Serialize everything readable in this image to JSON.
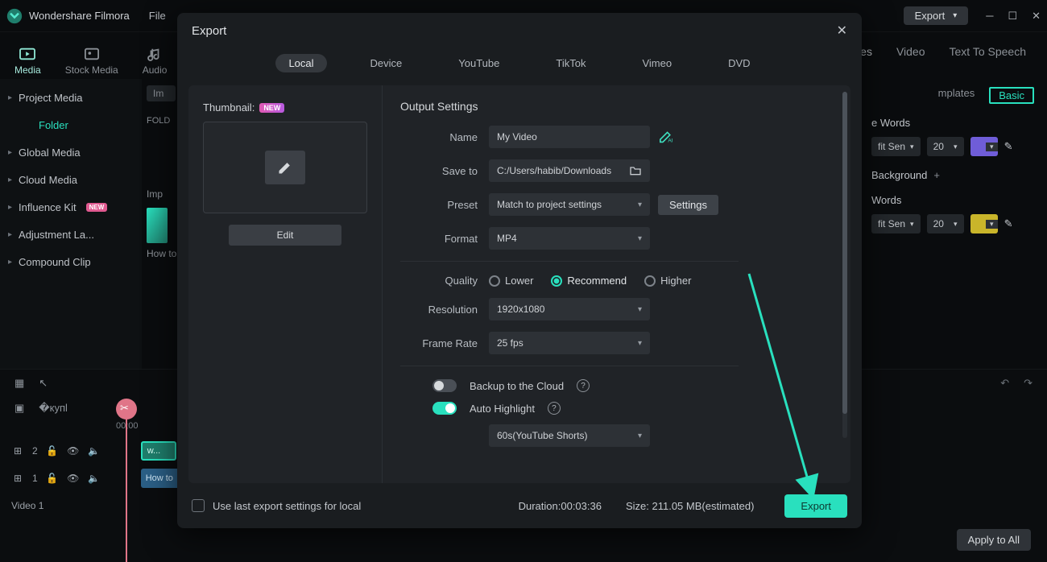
{
  "app": {
    "title": "Wondershare Filmora",
    "menu": [
      "File"
    ],
    "export_btn": "Export"
  },
  "nav": {
    "media": "Media",
    "stock": "Stock Media",
    "audio": "Audio"
  },
  "top_tabs": {
    "video": "Video",
    "tts": "Text To Speech",
    "templates_suffix": "mplates"
  },
  "sidebar": {
    "project_media": "Project Media",
    "folder": "Folder",
    "global": "Global Media",
    "cloud": "Cloud Media",
    "influence": "Influence Kit",
    "influence_badge": "NEW",
    "adjustment": "Adjustment La...",
    "compound": "Compound Clip"
  },
  "mid": {
    "imp": "Im",
    "fold": "FOLD",
    "imp2": "Imp",
    "howto": "How to"
  },
  "rightpanel": {
    "basic": "Basic",
    "words1": "e Words",
    "fit1": "fit Sen",
    "size1": "20",
    "bg": "Background",
    "words2": "Words",
    "fit2": "fit Sen",
    "size2": "20"
  },
  "timeline": {
    "time": "00;00",
    "track2_badge": "2",
    "track1_badge": "1",
    "clip_w": "w...",
    "clip_howto": "How to",
    "video1": "Video 1",
    "apply": "Apply to All"
  },
  "dialog": {
    "title": "Export",
    "tabs": {
      "local": "Local",
      "device": "Device",
      "youtube": "YouTube",
      "tiktok": "TikTok",
      "vimeo": "Vimeo",
      "dvd": "DVD"
    },
    "thumbnail_label": "Thumbnail:",
    "thumbnail_badge": "NEW",
    "edit": "Edit",
    "section": "Output Settings",
    "name_lbl": "Name",
    "name_val": "My Video",
    "save_lbl": "Save to",
    "save_val": "C:/Users/habib/Downloads",
    "preset_lbl": "Preset",
    "preset_val": "Match to project settings",
    "settings_btn": "Settings",
    "format_lbl": "Format",
    "format_val": "MP4",
    "quality_lbl": "Quality",
    "q_lower": "Lower",
    "q_rec": "Recommend",
    "q_higher": "Higher",
    "res_lbl": "Resolution",
    "res_val": "1920x1080",
    "fps_lbl": "Frame Rate",
    "fps_val": "25 fps",
    "backup": "Backup to the Cloud",
    "auto_hl": "Auto Highlight",
    "shorts_val": "60s(YouTube Shorts)",
    "use_last": "Use last export settings for local",
    "duration": "Duration:00:03:36",
    "size": "Size: 211.05 MB(estimated)",
    "export_btn": "Export"
  }
}
